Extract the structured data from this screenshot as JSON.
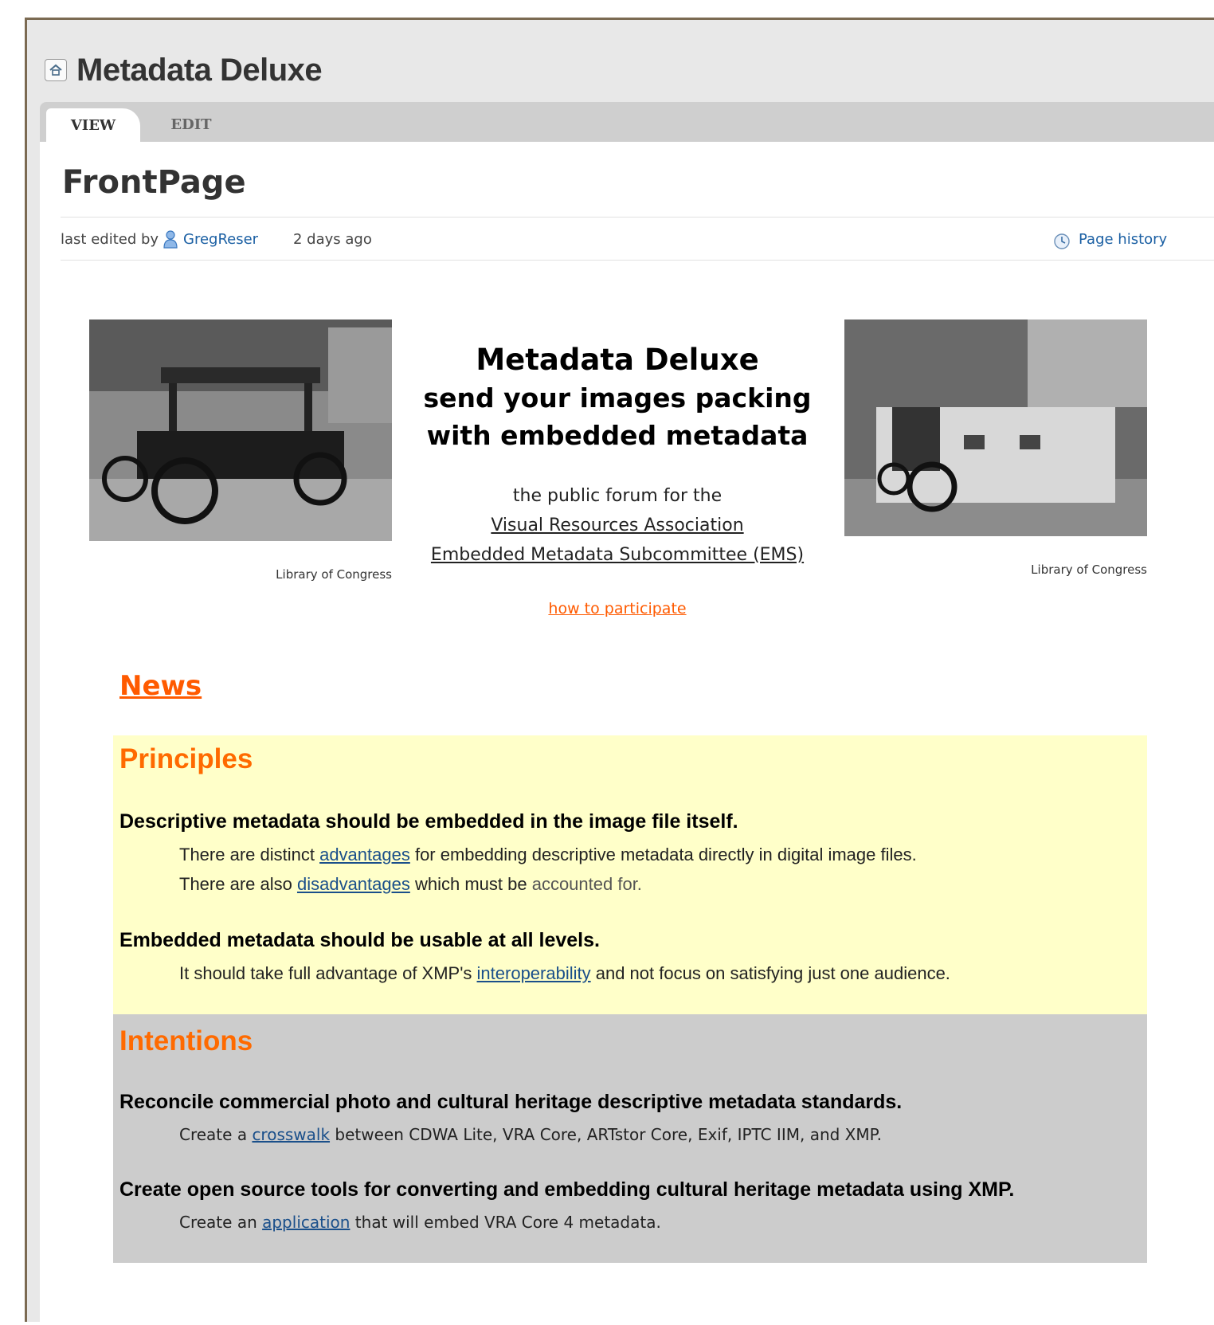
{
  "site": {
    "title": "Metadata Deluxe"
  },
  "tabs": [
    {
      "label": "VIEW",
      "active": true
    },
    {
      "label": "EDIT",
      "active": false
    }
  ],
  "page": {
    "name": "FrontPage",
    "last_edited_label": "last edited by",
    "editor": "GregReser",
    "edited_time": "2 days ago",
    "history_link": "Page history"
  },
  "hero": {
    "title": "Metadata Deluxe",
    "subtitle_line1": "send your images packing",
    "subtitle_line2": "with embedded metadata",
    "forum_intro": "the public forum for the",
    "vra_link": "Visual Resources Association",
    "ems_link": "Embedded Metadata Subcommittee (EMS)",
    "participate_link": "how to participate"
  },
  "images": [
    {
      "caption": "Library of Congress",
      "subject": "vintage-truck-photo"
    },
    {
      "caption": "Library of Congress",
      "subject": "car-tent-photo"
    }
  ],
  "news": {
    "heading": "News"
  },
  "principles": {
    "heading": "Principles",
    "items": [
      {
        "title": "Descriptive metadata should be embedded in the image file itself.",
        "line1_pre": "There are distinct ",
        "line1_link": "advantages",
        "line1_post": " for embedding descriptive metadata directly in digital image files.",
        "line2_pre": "There are also ",
        "line2_link": "disadvantages",
        "line2_mid": " which must be ",
        "line2_post": "accounted for."
      },
      {
        "title": "Embedded metadata should be usable at all levels.",
        "line1_pre": "It should take full advantage of XMP's ",
        "line1_link": "interoperability",
        "line1_post": " and not focus on satisfying just one audience."
      }
    ]
  },
  "intentions": {
    "heading": "Intentions",
    "items": [
      {
        "title": "Reconcile commercial photo and cultural heritage descriptive metadata standards.",
        "line1_pre": "Create a ",
        "line1_link": "crosswalk",
        "line1_post": " between CDWA Lite, VRA Core, ARTstor Core, Exif, IPTC IIM, and XMP."
      },
      {
        "title": "Create open source tools for converting and embedding cultural heritage metadata using XMP.",
        "line1_pre": "Create an ",
        "line1_link": "application",
        "line1_post": " that will embed VRA Core 4 metadata."
      }
    ]
  },
  "colors": {
    "accent_orange": "#ff6a00",
    "link_blue": "#1a4f8a",
    "principles_bg": "#ffffc9",
    "intentions_bg": "#cccccc"
  }
}
